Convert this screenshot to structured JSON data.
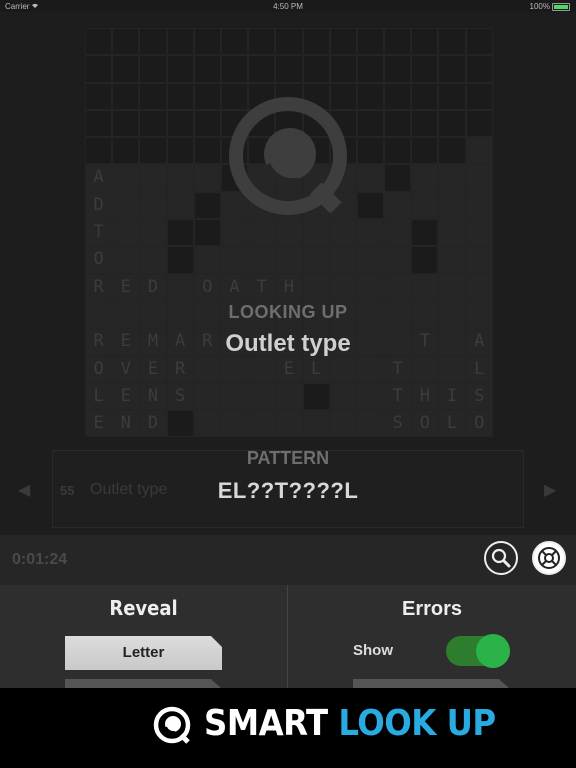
{
  "status_bar": {
    "carrier": "Carrier",
    "time": "4:50 PM",
    "battery": "100%"
  },
  "grid": {
    "rows": [
      "###############",
      "###############",
      "###############",
      "###############",
      "##############.",
      "A....#.....#...",
      "D...#.....#....",
      "T..##.......#..",
      "O..#........#..",
      "RED.OATH.......",
      "...............",
      "REMAR.......T.A",
      "OVER...EL..T..L",
      "LENS....#..THIS",
      "END#.......SOLO"
    ]
  },
  "overlay": {
    "looking_label": "LOOKING UP",
    "looking_clue": "Outlet type",
    "pattern_label": "PATTERN",
    "pattern_value": "EL??T????L"
  },
  "clue_bar": {
    "number": "55",
    "text": "Outlet type",
    "prev": "◀",
    "next": "▶"
  },
  "timer": "0:01:24",
  "reveal": {
    "title": "Reveal",
    "letter_button": "Letter"
  },
  "errors": {
    "title": "Errors",
    "show_label": "Show",
    "show_enabled": true
  },
  "banner": {
    "word1": "SMART",
    "word2": "LOOK UP"
  },
  "colors": {
    "accent_blue": "#29abe2",
    "toggle_green": "#2bb34a"
  },
  "icons": [
    "wifi-icon",
    "battery-icon",
    "search-icon",
    "help-lifebuoy-icon",
    "q-logo-icon"
  ]
}
